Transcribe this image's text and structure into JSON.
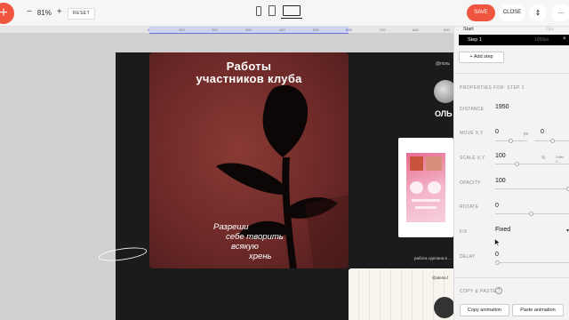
{
  "toolbar": {
    "add_label": "+",
    "zoom_minus": "−",
    "zoom_value": "81%",
    "zoom_plus": "+",
    "reset_label": "RESET",
    "save_label": "SAVE",
    "close_label": "CLOSE",
    "sort_label": "⇕",
    "more_label": "..."
  },
  "ruler": {
    "ticks": [
      "0",
      "100",
      "200",
      "300",
      "400",
      "500",
      "600",
      "700",
      "800",
      "900",
      "1000",
      "1100",
      "1200"
    ]
  },
  "postcard": {
    "title_line1": "Работы",
    "title_line2": "участников клуба",
    "text_line1": "Разреши",
    "text_line2": "себе творить",
    "text_line3": "всякую",
    "text_line4": "хрень"
  },
  "page": {
    "handle_top": "@поль",
    "name_fragment": "ОЛЬ",
    "caption": "работа сделана в ...",
    "handle_bottom": "@alena.f"
  },
  "panel": {
    "start_label": "Start",
    "start_value": "0px",
    "step_label": "Step 1",
    "step_value": "1950px",
    "step_close": "×",
    "add_step_label": "+ Add step",
    "properties_title": "PROPERTIES FOR: STEP 1",
    "distance_label": "DISTANCE",
    "distance_value": "1950",
    "move_label": "MOVE X,Y",
    "move_x": "0",
    "move_x_unit": "px",
    "move_y": "0",
    "scale_label": "SCALE X,Y",
    "scale_value": "100",
    "scale_unit": "%",
    "scale_differ": "Differ X...",
    "opacity_label": "OPACITY",
    "opacity_value": "100",
    "rotate_label": "ROTATE",
    "rotate_value": "0",
    "fix_label": "FIX",
    "fix_value": "Fixed",
    "delay_label": "DELAY",
    "delay_value": "0",
    "copy_paste_title": "COPY & PASTE",
    "copy_button": "Copy animation",
    "paste_button": "Paste animation"
  },
  "colors": {
    "accent": "#f0553f",
    "panel_bg": "#f3f3f3",
    "artboard_bg": "#1b1b1b",
    "postcard_bg": "#7a302c"
  }
}
